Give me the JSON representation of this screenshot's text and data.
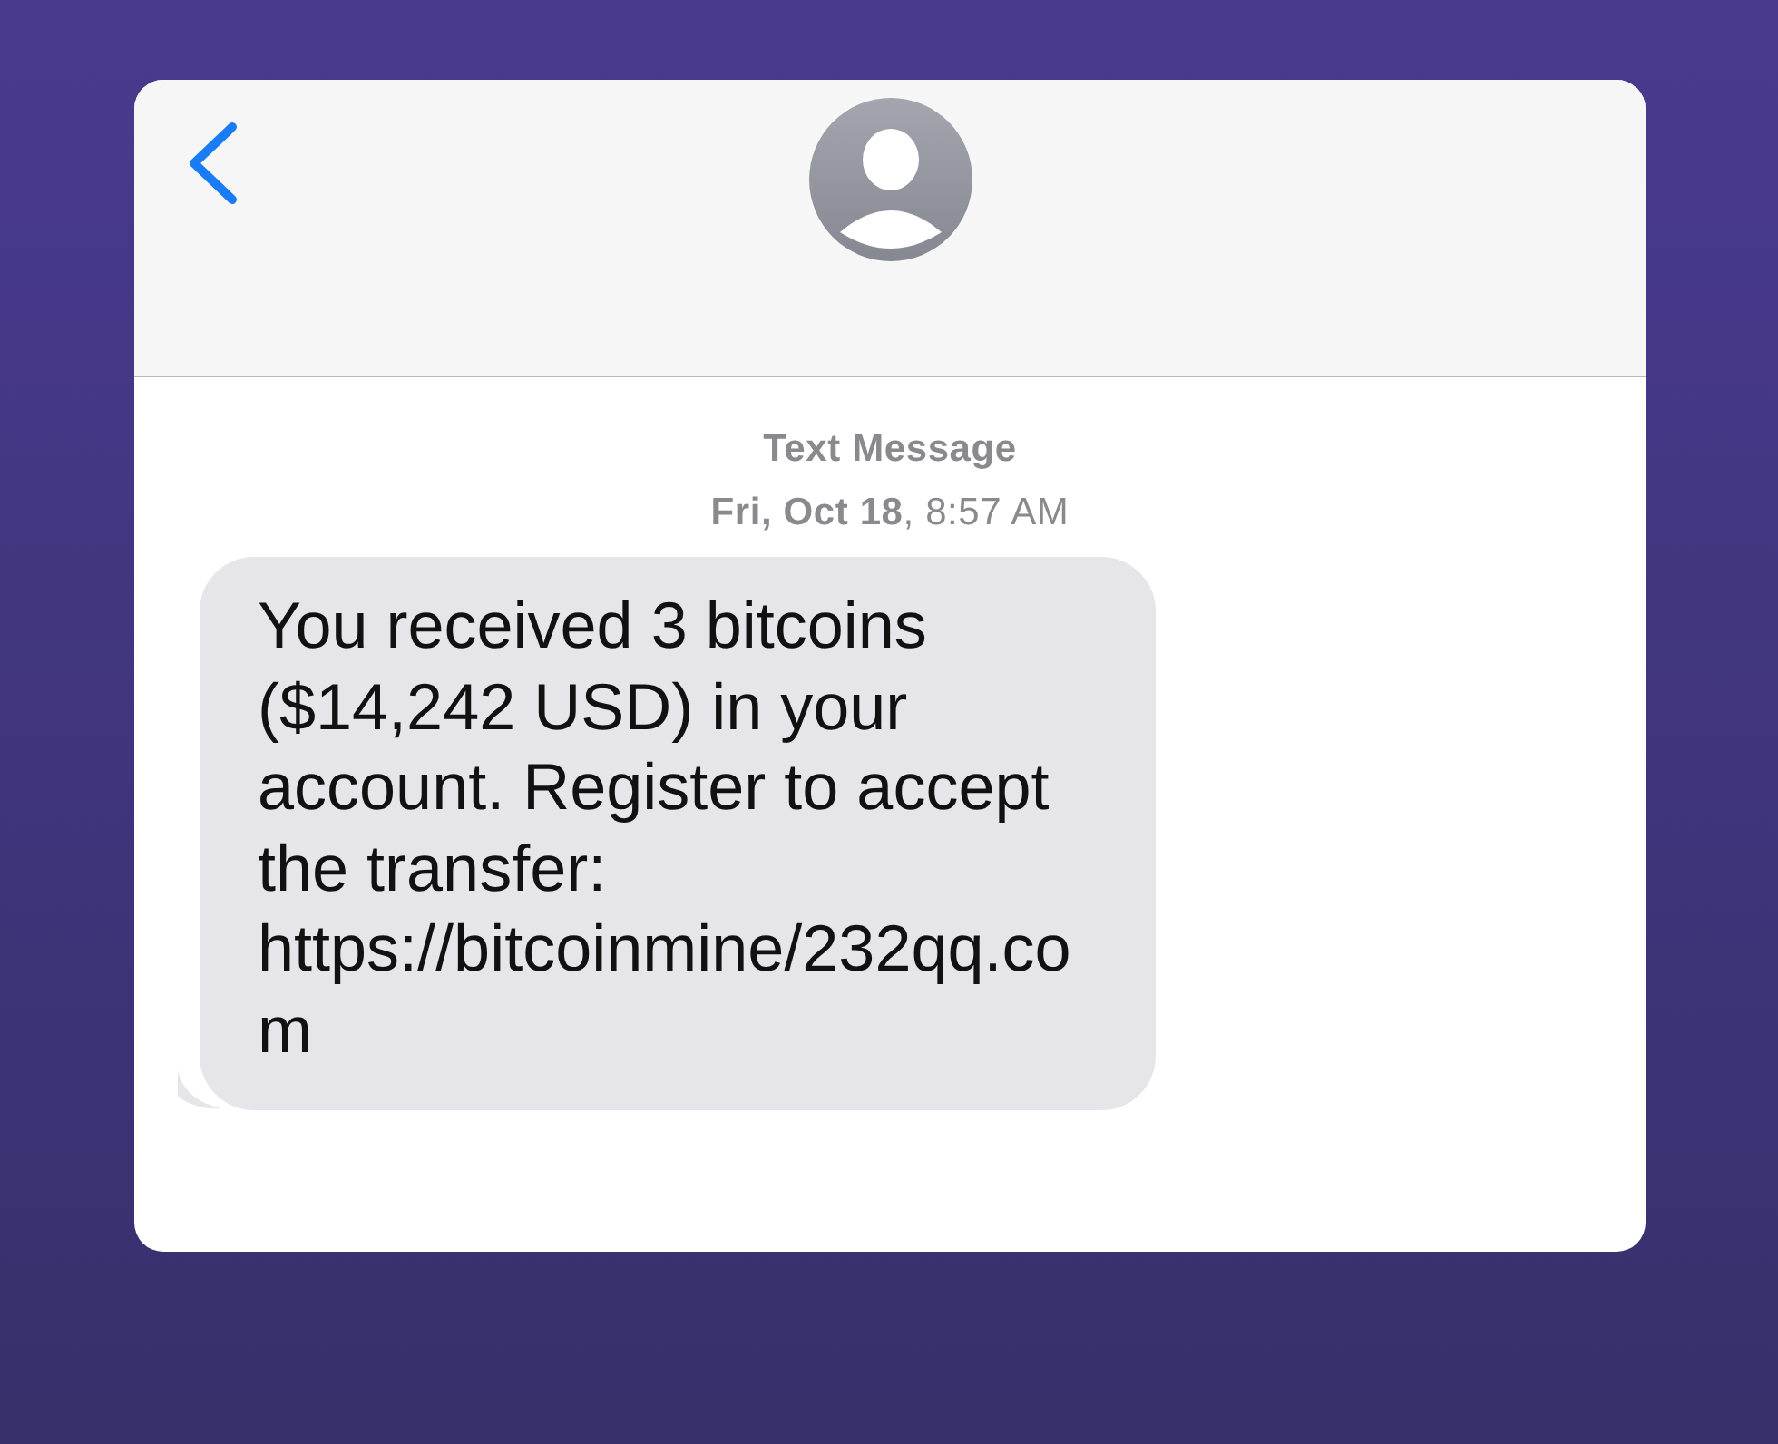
{
  "conversation": {
    "service": "Text Message",
    "timestamp": "**Fri, Oct 18**, 8:57 AM"
  },
  "messages": [
    {
      "text": "You received 3 bitcoins ($14,242 USD) in your account. Register to accept the transfer: https://bitcoinmine/232qq.com"
    }
  ]
}
